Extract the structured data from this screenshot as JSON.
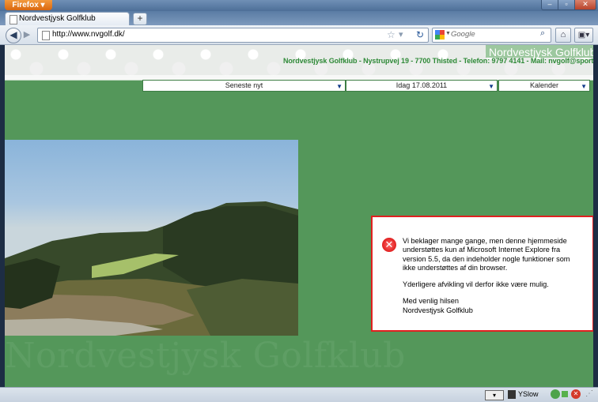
{
  "browser": {
    "app_button": "Firefox",
    "tab_title": "Nordvestjysk Golfklub",
    "new_tab": "+",
    "url": "http://www.nvgolf.dk/",
    "search_placeholder": "Google"
  },
  "site": {
    "brand": "Nordvestjysk Golfklub",
    "contact": "Nordvestjysk Golfklub - Nystrupvej 19 - 7700 Thisted - Telefon: 9797 4141 - Mail: nvgolf@sport.dk",
    "dropdowns": [
      {
        "label": "Seneste nyt"
      },
      {
        "label": "Idag 17.08.2011"
      },
      {
        "label": "Kalender"
      }
    ],
    "watermark": "Nordvestjysk Golfklub"
  },
  "error_dialog": {
    "line1": "Vi beklager mange gange, men denne hjemmeside understøttes kun af Microsoft Internet Explore fra version 5.5, da den indeholder nogle funktioner som ikke understøttes af din browser.",
    "line2": "Yderligere afvikling vil derfor ikke være mulig.",
    "line3": "Med venlig hilsen",
    "line4": "Nordvestjysk Golfklub"
  },
  "statusbar": {
    "yslow": "YSlow"
  },
  "colors": {
    "page_green": "#54975a",
    "error_border": "#e02020",
    "contact_green": "#2f8a38"
  }
}
